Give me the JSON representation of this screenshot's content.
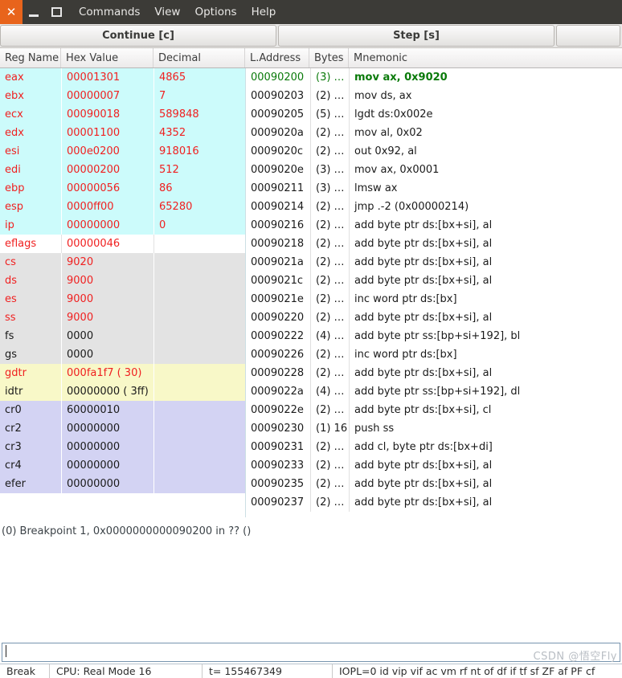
{
  "titlebar": {
    "close_icon": "close-icon",
    "minimize_icon": "minimize-icon",
    "maximize_icon": "maximize-icon",
    "close_glyph": "✕",
    "menus": [
      {
        "label": "Commands"
      },
      {
        "label": "View"
      },
      {
        "label": "Options"
      },
      {
        "label": "Help"
      }
    ]
  },
  "toolbar": {
    "continue_label": "Continue [c]",
    "step_label": "Step [s]",
    "extra_label": ""
  },
  "columns": {
    "reg_name": "Reg Name",
    "hex_value": "Hex Value",
    "decimal": "Decimal",
    "l_address": "L.Address",
    "bytes": "Bytes",
    "mnemonic": "Mnemonic"
  },
  "registers": [
    {
      "name": "eax",
      "hex": "00001301",
      "dec": "4865",
      "group": "gp",
      "changed": true
    },
    {
      "name": "ebx",
      "hex": "00000007",
      "dec": "7",
      "group": "gp",
      "changed": true
    },
    {
      "name": "ecx",
      "hex": "00090018",
      "dec": "589848",
      "group": "gp",
      "changed": true
    },
    {
      "name": "edx",
      "hex": "00001100",
      "dec": "4352",
      "group": "gp",
      "changed": true
    },
    {
      "name": "esi",
      "hex": "000e0200",
      "dec": "918016",
      "group": "gp",
      "changed": true
    },
    {
      "name": "edi",
      "hex": "00000200",
      "dec": "512",
      "group": "gp",
      "changed": true
    },
    {
      "name": "ebp",
      "hex": "00000056",
      "dec": "86",
      "group": "gp",
      "changed": true
    },
    {
      "name": "esp",
      "hex": "0000ff00",
      "dec": "65280",
      "group": "gp",
      "changed": true
    },
    {
      "name": "ip",
      "hex": "00000000",
      "dec": "0",
      "group": "gp",
      "changed": true
    },
    {
      "name": "eflags",
      "hex": "00000046",
      "dec": "",
      "group": "flag",
      "changed": true
    },
    {
      "name": "cs",
      "hex": "9020",
      "dec": "",
      "group": "seg",
      "changed": true
    },
    {
      "name": "ds",
      "hex": "9000",
      "dec": "",
      "group": "seg",
      "changed": true
    },
    {
      "name": "es",
      "hex": "9000",
      "dec": "",
      "group": "seg",
      "changed": true
    },
    {
      "name": "ss",
      "hex": "9000",
      "dec": "",
      "group": "seg",
      "changed": true
    },
    {
      "name": "fs",
      "hex": "0000",
      "dec": "",
      "group": "seg",
      "changed": false
    },
    {
      "name": "gs",
      "hex": "0000",
      "dec": "",
      "group": "seg",
      "changed": false
    },
    {
      "name": "gdtr",
      "hex": "000fa1f7 (  30)",
      "dec": "",
      "group": "dtr",
      "changed": true
    },
    {
      "name": "idtr",
      "hex": "00000000 ( 3ff)",
      "dec": "",
      "group": "dtr",
      "changed": false
    },
    {
      "name": "cr0",
      "hex": "60000010",
      "dec": "",
      "group": "cr",
      "changed": false
    },
    {
      "name": "cr2",
      "hex": "00000000",
      "dec": "",
      "group": "cr",
      "changed": false
    },
    {
      "name": "cr3",
      "hex": "00000000",
      "dec": "",
      "group": "cr",
      "changed": false
    },
    {
      "name": "cr4",
      "hex": "00000000",
      "dec": "",
      "group": "cr",
      "changed": false
    },
    {
      "name": "efer",
      "hex": "00000000",
      "dec": "",
      "group": "cr",
      "changed": false
    }
  ],
  "disassembly": [
    {
      "addr": "00090200",
      "bytes": "(3) …",
      "mnemonic": "mov ax, 0x9020",
      "current": true
    },
    {
      "addr": "00090203",
      "bytes": "(2) …",
      "mnemonic": "mov ds, ax",
      "current": false
    },
    {
      "addr": "00090205",
      "bytes": "(5) …",
      "mnemonic": "lgdt ds:0x002e",
      "current": false
    },
    {
      "addr": "0009020a",
      "bytes": "(2) …",
      "mnemonic": "mov al, 0x02",
      "current": false
    },
    {
      "addr": "0009020c",
      "bytes": "(2) …",
      "mnemonic": "out 0x92, al",
      "current": false
    },
    {
      "addr": "0009020e",
      "bytes": "(3) …",
      "mnemonic": "mov ax, 0x0001",
      "current": false
    },
    {
      "addr": "00090211",
      "bytes": "(3) …",
      "mnemonic": "lmsw ax",
      "current": false
    },
    {
      "addr": "00090214",
      "bytes": "(2) …",
      "mnemonic": "jmp .-2 (0x00000214)",
      "current": false
    },
    {
      "addr": "00090216",
      "bytes": "(2) …",
      "mnemonic": "add byte ptr ds:[bx+si], al",
      "current": false
    },
    {
      "addr": "00090218",
      "bytes": "(2) …",
      "mnemonic": "add byte ptr ds:[bx+si], al",
      "current": false
    },
    {
      "addr": "0009021a",
      "bytes": "(2) …",
      "mnemonic": "add byte ptr ds:[bx+si], al",
      "current": false
    },
    {
      "addr": "0009021c",
      "bytes": "(2) …",
      "mnemonic": "add byte ptr ds:[bx+si], al",
      "current": false
    },
    {
      "addr": "0009021e",
      "bytes": "(2) …",
      "mnemonic": "inc word ptr ds:[bx]",
      "current": false
    },
    {
      "addr": "00090220",
      "bytes": "(2) …",
      "mnemonic": "add byte ptr ds:[bx+si], al",
      "current": false
    },
    {
      "addr": "00090222",
      "bytes": "(4) …",
      "mnemonic": "add byte ptr ss:[bp+si+192], bl",
      "current": false
    },
    {
      "addr": "00090226",
      "bytes": "(2) …",
      "mnemonic": "inc word ptr ds:[bx]",
      "current": false
    },
    {
      "addr": "00090228",
      "bytes": "(2) …",
      "mnemonic": "add byte ptr ds:[bx+si], al",
      "current": false
    },
    {
      "addr": "0009022a",
      "bytes": "(4) …",
      "mnemonic": "add byte ptr ss:[bp+si+192], dl",
      "current": false
    },
    {
      "addr": "0009022e",
      "bytes": "(2) …",
      "mnemonic": "add byte ptr ds:[bx+si], cl",
      "current": false
    },
    {
      "addr": "00090230",
      "bytes": "(1) 16",
      "mnemonic": "push ss",
      "current": false
    },
    {
      "addr": "00090231",
      "bytes": "(2) …",
      "mnemonic": "add cl, byte ptr ds:[bx+di]",
      "current": false
    },
    {
      "addr": "00090233",
      "bytes": "(2) …",
      "mnemonic": "add byte ptr ds:[bx+si], al",
      "current": false
    },
    {
      "addr": "00090235",
      "bytes": "(2) …",
      "mnemonic": "add byte ptr ds:[bx+si], al",
      "current": false
    },
    {
      "addr": "00090237",
      "bytes": "(2) …",
      "mnemonic": "add byte ptr ds:[bx+si], al",
      "current": false
    }
  ],
  "log": {
    "line": "(0) Breakpoint 1, 0x0000000000090200 in ?? ()"
  },
  "command": {
    "value": "",
    "placeholder": ""
  },
  "statusbar": {
    "break": "Break",
    "cpu": "CPU: Real Mode 16",
    "ticks": "t= 155467349",
    "flags": "IOPL=0 id vip vif ac vm rf nt of df if tf sf ZF af PF cf"
  },
  "watermark": {
    "text": "CSDN @悟空Fly"
  },
  "colors": {
    "titlebar_bg": "#3c3b37",
    "close_btn": "#e8641c",
    "gp_row": "#ccfbfb",
    "seg_row": "#e3e3e3",
    "dtr_row": "#f8f8c8",
    "cr_row": "#d3d3f3",
    "changed_value": "#f02020",
    "current_instruction": "#0a7a0a"
  }
}
